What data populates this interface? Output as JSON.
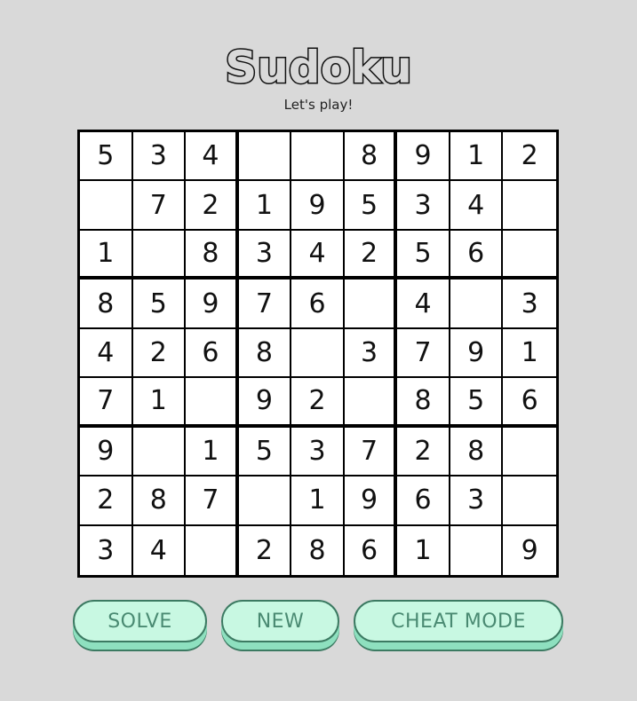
{
  "header": {
    "title": "Sudoku",
    "subtitle": "Let's play!"
  },
  "board": [
    [
      "5",
      "3",
      "4",
      "",
      "",
      "8",
      "9",
      "1",
      "2"
    ],
    [
      "",
      "7",
      "2",
      "1",
      "9",
      "5",
      "3",
      "4",
      ""
    ],
    [
      "1",
      "",
      "8",
      "3",
      "4",
      "2",
      "5",
      "6",
      ""
    ],
    [
      "8",
      "5",
      "9",
      "7",
      "6",
      "",
      "4",
      "",
      "3"
    ],
    [
      "4",
      "2",
      "6",
      "8",
      "",
      "3",
      "7",
      "9",
      "1"
    ],
    [
      "7",
      "1",
      "",
      "9",
      "2",
      "",
      "8",
      "5",
      "6"
    ],
    [
      "9",
      "",
      "1",
      "5",
      "3",
      "7",
      "2",
      "8",
      ""
    ],
    [
      "2",
      "8",
      "7",
      "",
      "1",
      "9",
      "6",
      "3",
      ""
    ],
    [
      "3",
      "4",
      "",
      "2",
      "8",
      "6",
      "1",
      "",
      "9"
    ]
  ],
  "buttons": {
    "solve": "SOLVE",
    "new": "NEW",
    "cheat": "CHEAT MODE"
  },
  "colors": {
    "background": "#d9d9d9",
    "button_fill": "#c8f8e2",
    "button_shadow": "#8ee0bf",
    "button_border": "#3c7a62",
    "button_text": "#4a8a72"
  }
}
